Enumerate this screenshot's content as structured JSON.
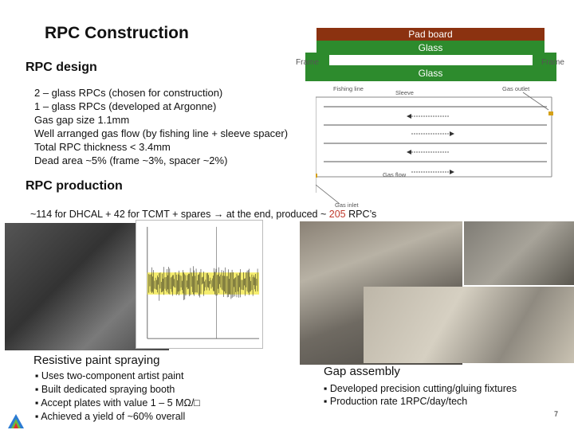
{
  "slide": {
    "title": "RPC Construction",
    "design_heading": "RPC design",
    "design_bullets": [
      "2 – glass RPCs (chosen for construction)",
      "1 – glass RPCs (developed at Argonne)",
      "Gas gap size 1.1mm",
      "Well arranged gas flow (by fishing line + sleeve spacer)",
      "Total RPC thickness < 3.4mm",
      "Dead area ~5% (frame ~3%, spacer ~2%)"
    ],
    "production_heading": "RPC production",
    "production_line_pre": "~114 for DHCAL + 42 for TCMT + spares → at the end, produced ~ ",
    "production_count": "205",
    "production_line_post": " RPC’s",
    "page_number": "7"
  },
  "diagram": {
    "pad_board": "Pad board",
    "glass_top": "Glass",
    "glass_bottom": "Glass",
    "frame_left": "Frame",
    "frame_right": "Frame",
    "fishing_line": "Fishing line",
    "sleeve": "Sleeve",
    "gas_outlet": "Gas outlet",
    "gas_flow": "Gas flow",
    "gas_inlet": "Gas inlet"
  },
  "captions": {
    "spraying_heading": "Resistive paint spraying",
    "spraying_bullets": [
      "Uses two-component artist paint",
      "Built dedicated spraying booth",
      "Accept plates with value 1 – 5 MΩ/□",
      "Achieved a yield of ~60% overall"
    ],
    "gap_heading": "Gap assembly",
    "gap_bullets": [
      "Developed precision cutting/gluing fixtures",
      "Production rate 1RPC/day/tech"
    ]
  },
  "colors": {
    "pad_board": "#8b3210",
    "glass": "#2d8b2d",
    "highlight": "#c0392b"
  }
}
